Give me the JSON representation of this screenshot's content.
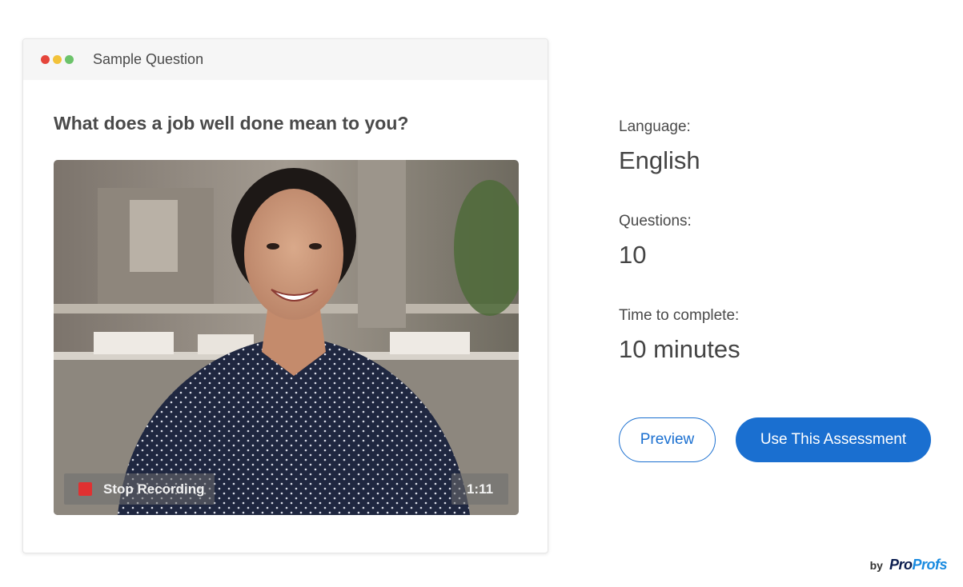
{
  "sample_card": {
    "title": "Sample Question",
    "window_dots": [
      "#e5453b",
      "#f2c23a",
      "#6cc36a"
    ],
    "question": "What does a job well done mean to you?",
    "video": {
      "stop_label": "Stop Recording",
      "timer": "1:11"
    }
  },
  "info": {
    "language_label": "Language:",
    "language_value": "English",
    "questions_label": "Questions:",
    "questions_value": "10",
    "time_label": "Time to complete:",
    "time_value": "10 minutes"
  },
  "actions": {
    "preview_label": "Preview",
    "use_label": "Use This Assessment"
  },
  "branding": {
    "by": "by",
    "pro": "Pro",
    "profs": "Profs"
  },
  "colors": {
    "primary": "#1a6fd0",
    "record_red": "#e03131"
  }
}
